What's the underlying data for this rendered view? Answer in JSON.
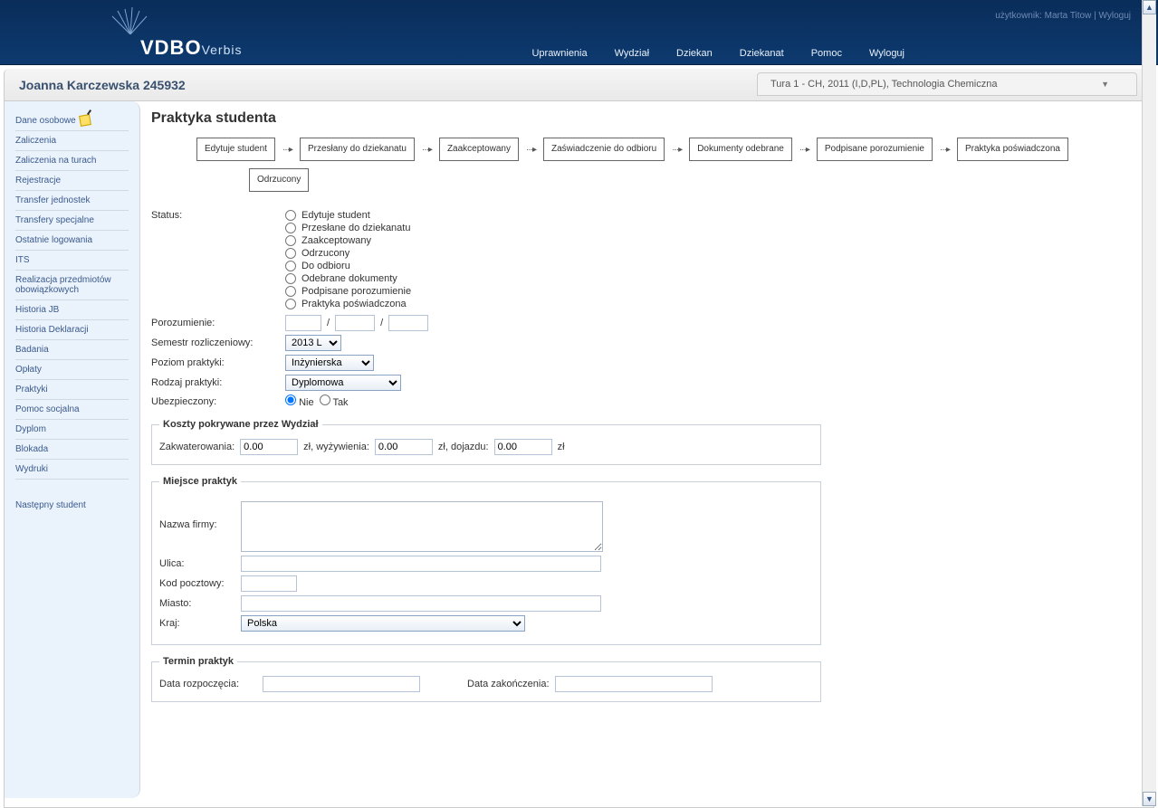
{
  "header": {
    "user_label": "użytkownik: ",
    "user_name": "Marta Titow",
    "logout_top": "Wyloguj",
    "logo_main": "VDBO",
    "logo_sub": "Verbis",
    "nav": {
      "uprawnienia": "Uprawnienia",
      "wydzial": "Wydział",
      "dziekan": "Dziekan",
      "dziekanat": "Dziekanat",
      "pomoc": "Pomoc",
      "wyloguj": "Wyloguj"
    }
  },
  "subheader": {
    "student": "Joanna Karczewska 245932",
    "tab_value": "Tura 1 - CH, 2011 (I,D,PL), Technologia Chemiczna"
  },
  "sidebar": {
    "items": [
      "Dane osobowe",
      "Zaliczenia",
      "Zaliczenia na turach",
      "Rejestracje",
      "Transfer jednostek",
      "Transfery specjalne",
      "Ostatnie logowania",
      "ITS",
      "Realizacja przedmiotów obowiązkowych",
      "Historia JB",
      "Historia Deklaracji",
      "Badania",
      "Opłaty",
      "Praktyki",
      "Pomoc socjalna",
      "Dyplom",
      "Blokada",
      "Wydruki"
    ],
    "nastepny": "Następny student"
  },
  "main": {
    "title": "Praktyka studenta",
    "workflow": [
      "Edytuje student",
      "Przesłany do dziekanatu",
      "Zaakceptowany",
      "Zaświadczenie do odbioru",
      "Dokumenty odebrane",
      "Podpisane porozumienie",
      "Praktyka poświadczona"
    ],
    "wf_rejected": "Odrzucony",
    "labels": {
      "status": "Status:",
      "porozumienie": "Porozumienie:",
      "semestr": "Semestr rozliczeniowy:",
      "poziom": "Poziom praktyki:",
      "rodzaj": "Rodzaj praktyki:",
      "ubezpieczony": "Ubezpieczony:",
      "nie": "Nie",
      "tak": "Tak"
    },
    "status_options": [
      "Edytuje student",
      "Przesłane do dziekanatu",
      "Zaakceptowany",
      "Odrzucony",
      "Do odbioru",
      "Odebrane dokumenty",
      "Podpisane porozumienie",
      "Praktyka poświadczona"
    ],
    "semestr_value": "2013 L",
    "poziom_value": "Inżynierska",
    "rodzaj_value": "Dyplomowa",
    "koszty": {
      "legend": "Koszty pokrywane przez Wydział",
      "zakwaterowania_label": "Zakwaterowania:",
      "zakwaterowania_value": "0.00",
      "wyzywienia_label": "zł, wyżywienia:",
      "wyzywienia_value": "0.00",
      "dojazdu_label": "zł, dojazdu:",
      "dojazdu_value": "0.00",
      "zl": "zł"
    },
    "miejsce": {
      "legend": "Miejsce praktyk",
      "nazwa_label": "Nazwa firmy:",
      "ulica_label": "Ulica:",
      "kod_label": "Kod pocztowy:",
      "miasto_label": "Miasto:",
      "kraj_label": "Kraj:",
      "kraj_value": "Polska"
    },
    "termin": {
      "legend": "Termin praktyk",
      "rozpoczecia_label": "Data rozpoczęcia:",
      "zakonczenia_label": "Data zakończenia:"
    }
  }
}
